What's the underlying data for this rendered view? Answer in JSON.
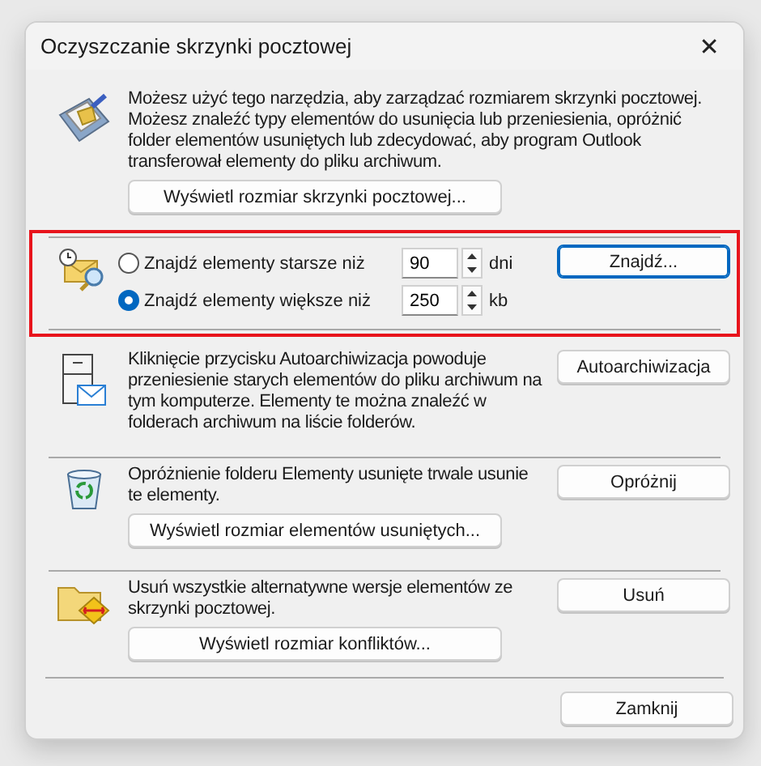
{
  "window": {
    "title": "Oczyszczanie skrzynki pocztowej",
    "close": "✕"
  },
  "sections": [
    {
      "kind": "intro",
      "highlighted": false,
      "text": "Możesz użyć tego narzędzia, aby zarządzać rozmiarem skrzynki pocztowej.\nMożesz znaleźć typy elementów do usunięcia lub przeniesienia, opróżnić folder elementów usuniętych lub zdecydować, aby program Outlook transferował elementy do pliku archiwum.",
      "sub_button": "Wyświetl rozmiar skrzynki pocztowej..."
    },
    {
      "kind": "find",
      "highlighted": true,
      "options": [
        {
          "label": "Znajdź elementy starsze niż",
          "selected": false,
          "value": "90",
          "unit": "dni"
        },
        {
          "label": "Znajdź elementy większe niż",
          "selected": true,
          "value": "250",
          "unit": "kb"
        }
      ],
      "button": "Znajdź..."
    },
    {
      "kind": "archive",
      "highlighted": false,
      "text": "Kliknięcie przycisku Autoarchiwizacja powoduje przeniesienie starych elementów do pliku archiwum na tym komputerze. Elementy te można znaleźć w folderach archiwum na liście folderów.",
      "button": "Autoarchiwizacja"
    },
    {
      "kind": "empty",
      "highlighted": false,
      "text": "Opróżnienie folderu Elementy usunięte trwale usunie te elementy.",
      "sub_button": "Wyświetl rozmiar elementów usuniętych...",
      "button": "Opróżnij"
    },
    {
      "kind": "conflicts",
      "highlighted": false,
      "text": "Usuń wszystkie alternatywne wersje elementów ze skrzynki pocztowej.",
      "sub_button": "Wyświetl rozmiar konfliktów...",
      "button": "Usuń"
    }
  ],
  "close_button": "Zamknij"
}
